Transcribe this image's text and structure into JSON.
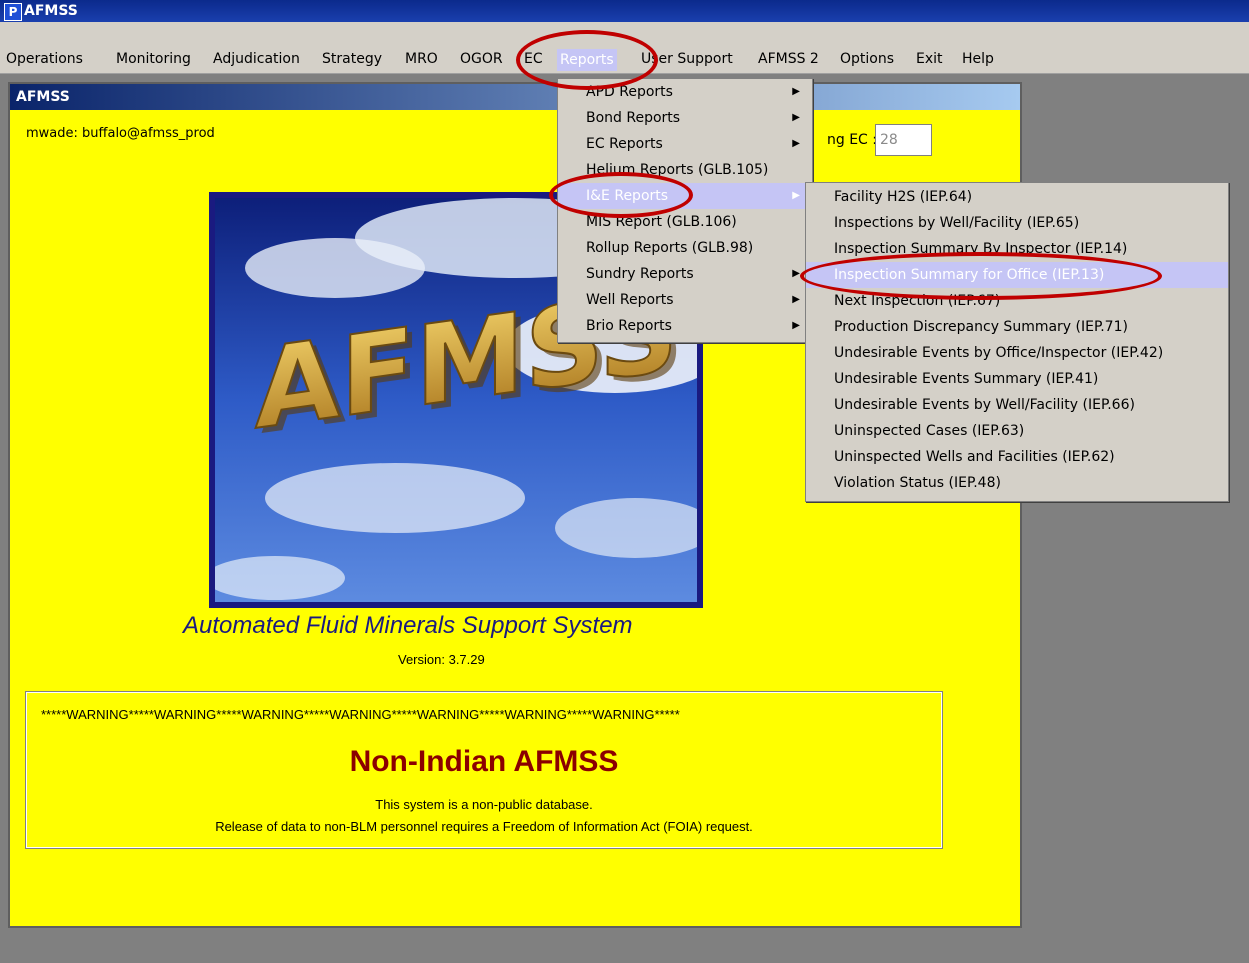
{
  "window": {
    "title": "AFMSS",
    "app_icon_letter": "P"
  },
  "menubar": {
    "items": [
      {
        "label": "Operations"
      },
      {
        "label": "Monitoring"
      },
      {
        "label": "Adjudication"
      },
      {
        "label": "Strategy"
      },
      {
        "label": "MRO"
      },
      {
        "label": "OGOR"
      },
      {
        "label": "EC"
      },
      {
        "label": "Reports"
      },
      {
        "label": "User Support"
      },
      {
        "label": "AFMSS 2"
      },
      {
        "label": "Options"
      },
      {
        "label": "Exit"
      },
      {
        "label": "Help"
      }
    ]
  },
  "child_window": {
    "title": "AFMSS"
  },
  "session": {
    "user": "mwade: buffalo@afmss_prod",
    "ec_label": "ng EC :",
    "ec_value": "28"
  },
  "splash": {
    "logo_text": "AFMSS",
    "app_name": "Automated Fluid Minerals Support System",
    "version": "Version: 3.7.29"
  },
  "warning": {
    "banner": "*****WARNING*****WARNING*****WARNING*****WARNING*****WARNING*****WARNING*****WARNING*****",
    "title": "Non-Indian AFMSS",
    "line1": "This system is a non-public database.",
    "line2": "Release of data to non-BLM personnel requires a Freedom of Information Act (FOIA) request."
  },
  "reports_menu": {
    "items": [
      {
        "label": "APD Reports",
        "submenu": true
      },
      {
        "label": "Bond Reports",
        "submenu": true
      },
      {
        "label": "EC Reports",
        "submenu": true
      },
      {
        "label": "Helium Reports (GLB.105)",
        "submenu": false
      },
      {
        "label": "I&E Reports",
        "submenu": true
      },
      {
        "label": "MIS Report (GLB.106)",
        "submenu": false
      },
      {
        "label": "Rollup Reports (GLB.98)",
        "submenu": false
      },
      {
        "label": "Sundry Reports",
        "submenu": true
      },
      {
        "label": "Well Reports",
        "submenu": true
      },
      {
        "label": "Brio Reports",
        "submenu": true
      }
    ]
  },
  "ie_menu": {
    "items": [
      {
        "label": "Facility H2S (IEP.64)"
      },
      {
        "label": "Inspections by Well/Facility (IEP.65)"
      },
      {
        "label": "Inspection Summary By Inspector (IEP.14)"
      },
      {
        "label": "Inspection Summary for Office (IEP.13)"
      },
      {
        "label": "Next Inspection (IEP.67)"
      },
      {
        "label": "Production Discrepancy Summary (IEP.71)"
      },
      {
        "label": "Undesirable Events by Office/Inspector (IEP.42)"
      },
      {
        "label": "Undesirable Events Summary (IEP.41)"
      },
      {
        "label": "Undesirable Events by Well/Facility (IEP.66)"
      },
      {
        "label": "Uninspected Cases (IEP.63)"
      },
      {
        "label": "Uninspected Wells and Facilities (IEP.62)"
      },
      {
        "label": "Violation Status (IEP.48)"
      }
    ]
  },
  "colors": {
    "background": "#ffff00",
    "menu": "#d4d0c8",
    "highlight": "#c5c5f5",
    "annotation": "#c00000"
  }
}
